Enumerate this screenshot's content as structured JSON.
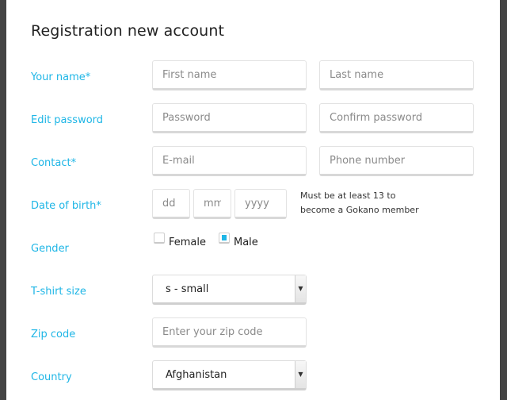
{
  "form": {
    "title": "Registration new account",
    "labels": {
      "name": "Your name*",
      "password": "Edit password",
      "contact": "Contact*",
      "dob": "Date of birth*",
      "gender": "Gender",
      "tshirt": "T-shirt size",
      "zip": "Zip code",
      "country": "Country"
    },
    "placeholders": {
      "first_name": "First name",
      "last_name": "Last name",
      "password": "Password",
      "confirm_password": "Confirm password",
      "email": "E-mail",
      "phone": "Phone number",
      "dd": "dd",
      "mm": "mm",
      "yyyy": "yyyy",
      "zip": "Enter your zip code"
    },
    "dob_note_line1": "Must be at least 13 to",
    "dob_note_line2": "become a Gokano member",
    "gender": {
      "female_label": "Female",
      "male_label": "Male",
      "selected": "Male"
    },
    "tshirt_value": "s - small",
    "country_value": "Afghanistan",
    "dropdown_icon": "chevron-down-icon",
    "accent_color": "#1fb6e6"
  }
}
